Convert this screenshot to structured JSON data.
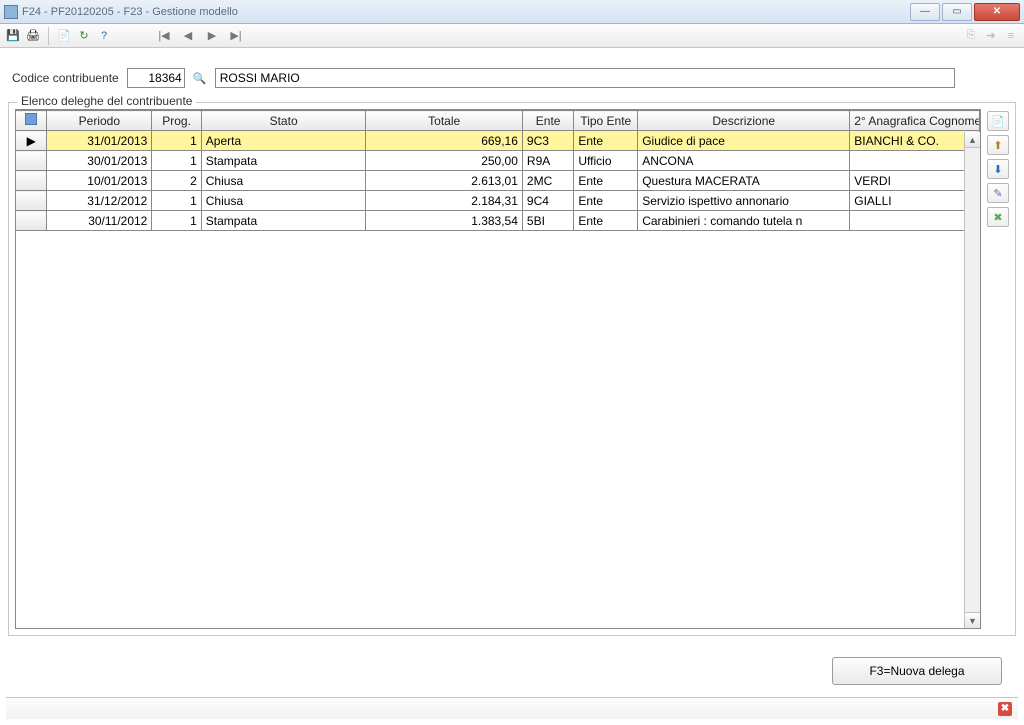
{
  "window": {
    "title": "F24  -  PF20120205  -  F23 - Gestione modello"
  },
  "form": {
    "codice_label": "Codice contribuente",
    "codice_value": "18364",
    "name_value": "ROSSI MARIO"
  },
  "fieldset": {
    "legend": "Elenco deleghe del contribuente"
  },
  "grid": {
    "headers": [
      "Periodo",
      "Prog.",
      "Stato",
      "Totale",
      "Ente",
      "Tipo Ente",
      "Descrizione",
      "2° Anagrafica Cognome"
    ],
    "rows": [
      {
        "periodo": "31/01/2013",
        "prog": "1",
        "stato": "Aperta",
        "totale": "669,16",
        "ente": "9C3",
        "tipo": "Ente",
        "descr": "Giudice di pace",
        "anag": "BIANCHI & CO.",
        "selected": true
      },
      {
        "periodo": "30/01/2013",
        "prog": "1",
        "stato": "Stampata",
        "totale": "250,00",
        "ente": "R9A",
        "tipo": "Ufficio",
        "descr": "ANCONA",
        "anag": ""
      },
      {
        "periodo": "10/01/2013",
        "prog": "2",
        "stato": "Chiusa",
        "totale": "2.613,01",
        "ente": "2MC",
        "tipo": "Ente",
        "descr": "Questura MACERATA",
        "anag": "VERDI"
      },
      {
        "periodo": "31/12/2012",
        "prog": "1",
        "stato": "Chiusa",
        "totale": "2.184,31",
        "ente": "9C4",
        "tipo": "Ente",
        "descr": "Servizio ispettivo annonario",
        "anag": "GIALLI"
      },
      {
        "periodo": "30/11/2012",
        "prog": "1",
        "stato": "Stampata",
        "totale": "1.383,54",
        "ente": "5BI",
        "tipo": "Ente",
        "descr": "Carabinieri : comando tutela n",
        "anag": ""
      }
    ]
  },
  "footer": {
    "new_label": "F3=Nuova delega"
  }
}
